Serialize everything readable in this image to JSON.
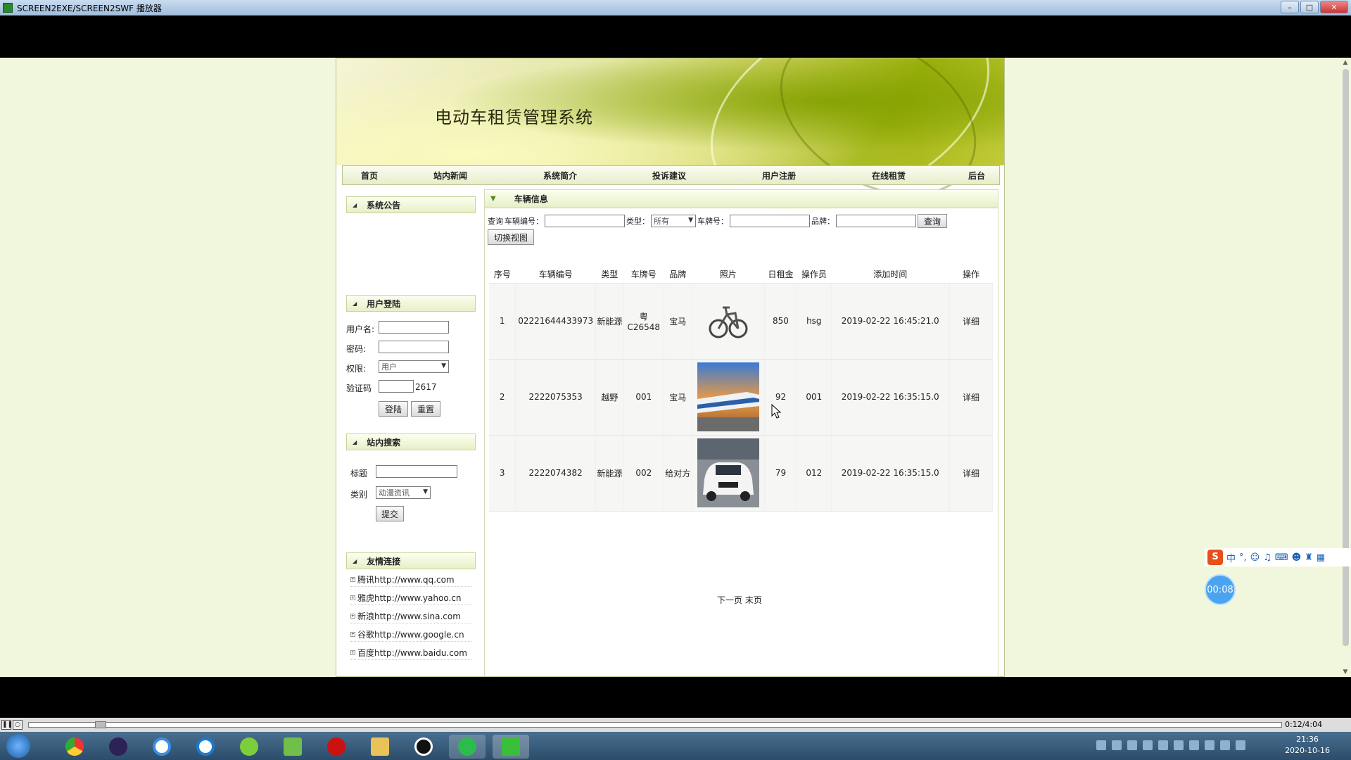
{
  "window": {
    "title": "SCREEN2EXE/SCREEN2SWF 播放器"
  },
  "site": {
    "title": "电动车租赁管理系统",
    "nav": [
      "首页",
      "站内新闻",
      "系统简介",
      "投诉建议",
      "用户注册",
      "在线租赁",
      "后台"
    ]
  },
  "left": {
    "notice_title": "系统公告",
    "login": {
      "title": "用户登陆",
      "username_label": "用户名:",
      "password_label": "密码:",
      "role_label": "权限:",
      "role_value": "用户",
      "captcha_label": "验证码",
      "captcha_code": "2617",
      "login_button": "登陆",
      "reset_button": "重置"
    },
    "search": {
      "title": "站内搜索",
      "title_label": "标题",
      "category_label": "类别",
      "category_value": "动漫资讯",
      "submit_button": "提交"
    },
    "links": {
      "title": "友情连接",
      "items": [
        "腾讯http://www.qq.com",
        "雅虎http://www.yahoo.cn",
        "新浪http://www.sina.com",
        "谷歌http://www.google.cn",
        "百度http://www.baidu.com"
      ]
    }
  },
  "main": {
    "title": "车辆信息",
    "filter": {
      "query_label": "查询",
      "vehicle_no_label": "车辆编号：",
      "type_label": "类型：",
      "type_value": "所有",
      "plate_label": "车牌号：",
      "brand_label": "品牌：",
      "query_button": "查询",
      "switch_view_button": "切换视图"
    },
    "columns": [
      "序号",
      "车辆编号",
      "类型",
      "车牌号",
      "品牌",
      "照片",
      "日租金",
      "操作员",
      "添加时间",
      "操作"
    ],
    "rows": [
      {
        "seq": "1",
        "vehicle_no": "02221644433973",
        "type": "新能源",
        "plate": "粤C26548",
        "brand": "宝马",
        "photo": "bicycle",
        "rent": "850",
        "operator": "hsg",
        "added": "2019-02-22 16:45:21.0",
        "action": "详细"
      },
      {
        "seq": "2",
        "vehicle_no": "2222075353",
        "type": "越野",
        "plate": "001",
        "brand": "宝马",
        "photo": "train",
        "rent": "92",
        "operator": "001",
        "added": "2019-02-22 16:35:15.0",
        "action": "详细"
      },
      {
        "seq": "3",
        "vehicle_no": "2222074382",
        "type": "新能源",
        "plate": "002",
        "brand": "给对方",
        "photo": "car",
        "rent": "79",
        "operator": "012",
        "added": "2019-02-22 16:35:15.0",
        "action": "详细"
      }
    ],
    "pager": "下一页 末页"
  },
  "player": {
    "time": "0:12/4:04"
  },
  "overlay": {
    "timer": "00:08",
    "ime_label": "中"
  },
  "clock": {
    "time": "21:36",
    "date": "2020-10-16"
  }
}
